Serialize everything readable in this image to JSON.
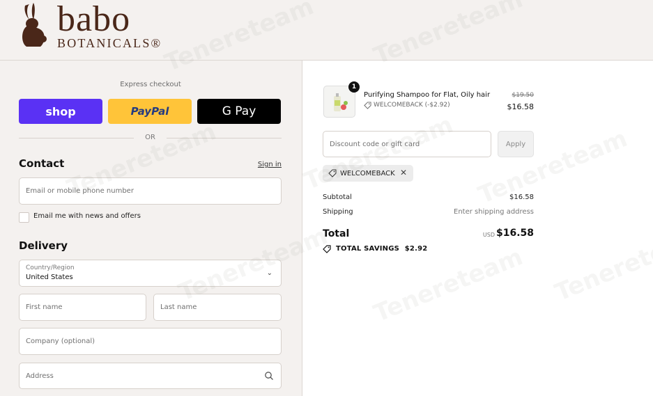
{
  "brand": {
    "name": "babo",
    "sub": "BOTANICALS®",
    "color": "#4a2719"
  },
  "express": {
    "label": "Express checkout",
    "shop": "shop",
    "paypal": "PayPal",
    "gpay": "G Pay",
    "or": "OR"
  },
  "contact": {
    "title": "Contact",
    "sign_in": "Sign in",
    "email_placeholder": "Email or mobile phone number",
    "news_label": "Email me with news and offers"
  },
  "delivery": {
    "title": "Delivery",
    "country_label": "Country/Region",
    "country_value": "United States",
    "first_name": "First name",
    "last_name": "Last name",
    "company": "Company (optional)",
    "address": "Address"
  },
  "order": {
    "item": {
      "quantity": "1",
      "name": "Purifying Shampoo for Flat, Oily hair",
      "discount": "WELCOMEBACK (-$2.92)",
      "old_price": "$19.50",
      "price": "$16.58"
    },
    "discount_placeholder": "Discount code or gift card",
    "apply": "Apply",
    "applied_code": "WELCOMEBACK",
    "subtotal_label": "Subtotal",
    "subtotal_value": "$16.58",
    "shipping_label": "Shipping",
    "shipping_value": "Enter shipping address",
    "total_label": "Total",
    "currency": "USD",
    "total_value": "$16.58",
    "savings_label": "TOTAL SAVINGS",
    "savings_value": "$2.92"
  },
  "colors": {
    "shop": "#5a31f4",
    "paypal": "#ffc439",
    "gpay": "#000000"
  },
  "watermark": "Tenereteam"
}
